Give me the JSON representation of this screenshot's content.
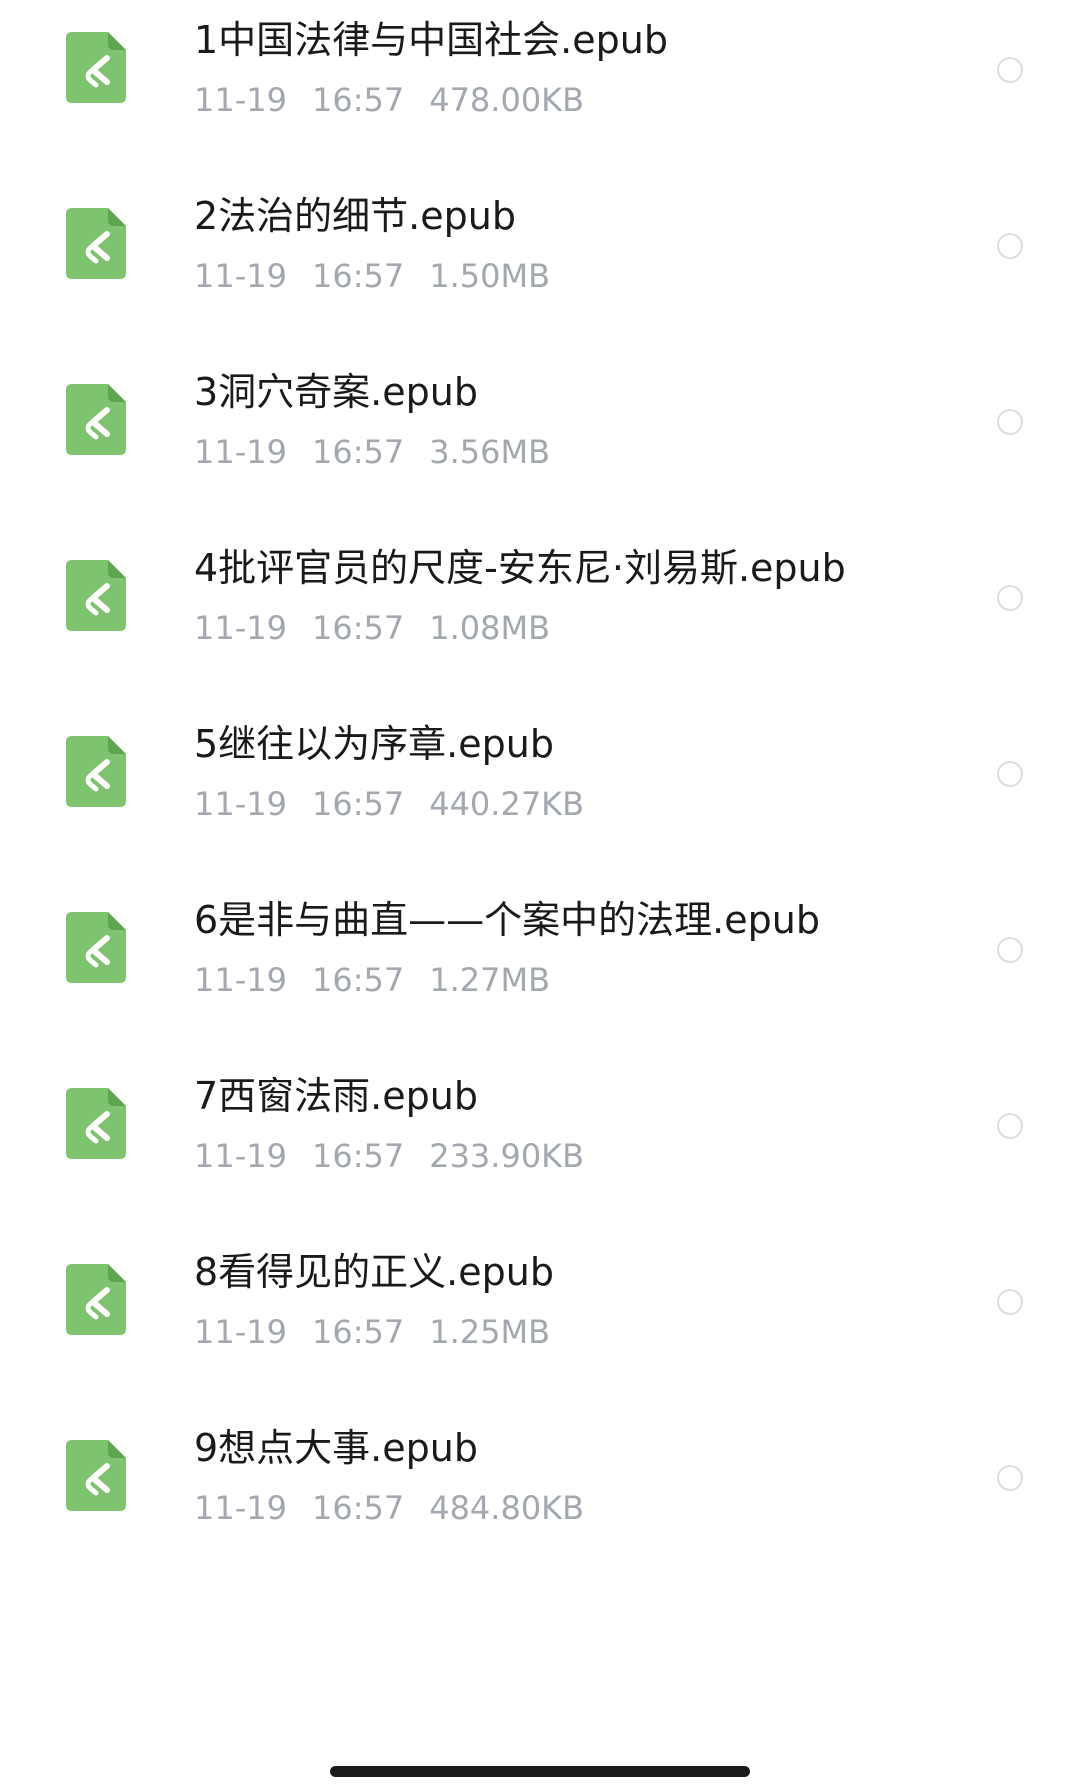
{
  "colors": {
    "icon_green": "#7ec46f",
    "icon_fold": "#5ea550",
    "meta_gray": "#a3a8b0",
    "radio_border": "#dcdcdc"
  },
  "files": [
    {
      "name": "1中国法律与中国社会.epub",
      "date": "11-19",
      "time": "16:57",
      "size": "478.00KB",
      "icon": "epub-file-icon"
    },
    {
      "name": "2法治的细节.epub",
      "date": "11-19",
      "time": "16:57",
      "size": "1.50MB",
      "icon": "epub-file-icon"
    },
    {
      "name": "3洞穴奇案.epub",
      "date": "11-19",
      "time": "16:57",
      "size": "3.56MB",
      "icon": "epub-file-icon"
    },
    {
      "name": "4批评官员的尺度-安东尼·刘易斯.epub",
      "date": "11-19",
      "time": "16:57",
      "size": "1.08MB",
      "icon": "epub-file-icon"
    },
    {
      "name": "5继往以为序章.epub",
      "date": "11-19",
      "time": "16:57",
      "size": "440.27KB",
      "icon": "epub-file-icon"
    },
    {
      "name": "6是非与曲直——个案中的法理.epub",
      "date": "11-19",
      "time": "16:57",
      "size": "1.27MB",
      "icon": "epub-file-icon"
    },
    {
      "name": "7西窗法雨.epub",
      "date": "11-19",
      "time": "16:57",
      "size": "233.90KB",
      "icon": "epub-file-icon"
    },
    {
      "name": "8看得见的正义.epub",
      "date": "11-19",
      "time": "16:57",
      "size": "1.25MB",
      "icon": "epub-file-icon"
    },
    {
      "name": "9想点大事.epub",
      "date": "11-19",
      "time": "16:57",
      "size": "484.80KB",
      "icon": "epub-file-icon"
    }
  ]
}
